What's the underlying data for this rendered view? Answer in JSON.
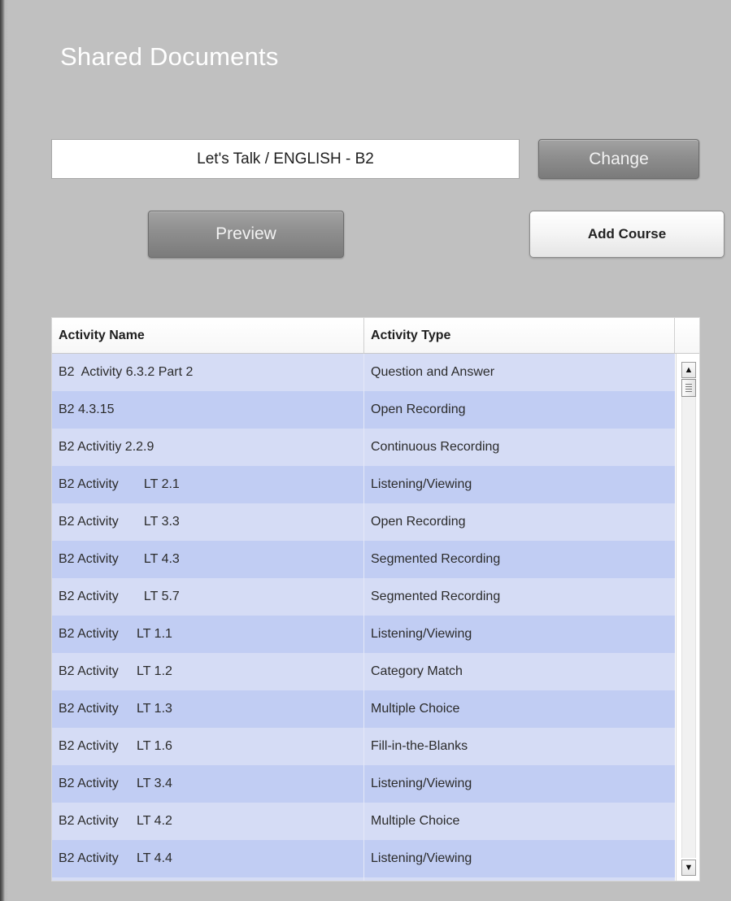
{
  "page": {
    "title": "Shared Documents"
  },
  "course_selector": {
    "value": "Let's Talk / ENGLISH - B2",
    "change_label": "Change"
  },
  "actions": {
    "preview_label": "Preview",
    "add_course_label": "Add Course"
  },
  "activity_table": {
    "headers": {
      "name": "Activity Name",
      "type": "Activity Type"
    },
    "rows": [
      {
        "name": "B2  Activity 6.3.2 Part 2",
        "type": "Question and Answer"
      },
      {
        "name": "B2 4.3.15",
        "type": "Open Recording"
      },
      {
        "name": "B2 Activitiy 2.2.9",
        "type": "Continuous Recording"
      },
      {
        "name": "B2 Activity       LT 2.1",
        "type": "Listening/Viewing"
      },
      {
        "name": "B2 Activity       LT 3.3",
        "type": "Open Recording"
      },
      {
        "name": "B2 Activity       LT 4.3",
        "type": "Segmented Recording"
      },
      {
        "name": "B2 Activity       LT 5.7",
        "type": "Segmented Recording"
      },
      {
        "name": "B2 Activity     LT 1.1",
        "type": "Listening/Viewing"
      },
      {
        "name": "B2 Activity     LT 1.2",
        "type": "Category Match"
      },
      {
        "name": "B2 Activity     LT 1.3",
        "type": "Multiple Choice"
      },
      {
        "name": "B2 Activity     LT 1.6",
        "type": "Fill-in-the-Blanks"
      },
      {
        "name": "B2 Activity     LT 3.4",
        "type": "Listening/Viewing"
      },
      {
        "name": "B2 Activity     LT 4.2",
        "type": "Multiple Choice"
      },
      {
        "name": "B2 Activity     LT 4.4",
        "type": "Listening/Viewing"
      },
      {
        "name": "",
        "type": ""
      }
    ],
    "scrollbar": {
      "up_icon": "▲",
      "down_icon": "▼",
      "position_fraction": 0.0
    }
  },
  "colors": {
    "background": "#c0c0c0",
    "row_even": "#d5dcf5",
    "row_odd": "#c1cdf3",
    "button_dark": "#8e8e8e"
  }
}
